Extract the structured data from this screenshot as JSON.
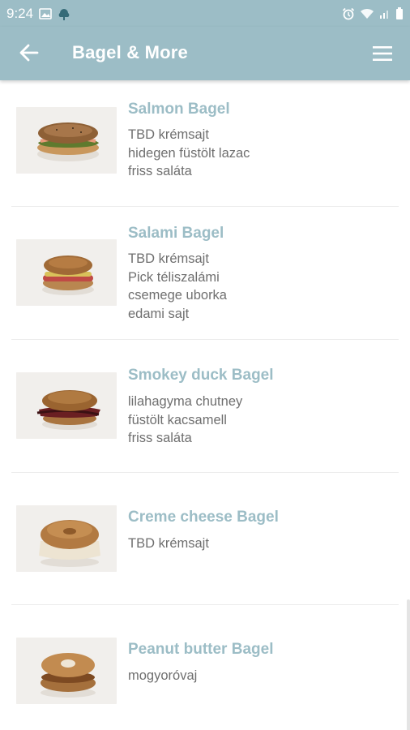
{
  "status_bar": {
    "time": "9:24",
    "icons_left": [
      "image-icon",
      "cloud-icon"
    ],
    "icons_right": [
      "alarm-icon",
      "wifi-icon",
      "signal-icon",
      "battery-icon"
    ]
  },
  "app_bar": {
    "title": "Bagel & More",
    "back_icon": "arrow-left-icon",
    "menu_icon": "hamburger-menu-icon"
  },
  "colors": {
    "accent": "#9cbdc6",
    "text_muted": "#6f6f6f"
  },
  "items": [
    {
      "name": "Salmon Bagel",
      "lines": [
        "TBD krémsajt",
        "hidegen füstölt lazac",
        "friss saláta"
      ],
      "image": "bagel-salmon"
    },
    {
      "name": "Salami Bagel",
      "lines": [
        "TBD krémsajt",
        "Pick téliszalámi",
        "csemege uborka",
        "edami sajt"
      ],
      "image": "bagel-salami"
    },
    {
      "name": "Smokey duck Bagel",
      "lines": [
        "lilahagyma chutney",
        "füstölt kacsamell",
        "friss saláta"
      ],
      "image": "bagel-duck"
    },
    {
      "name": "Creme cheese Bagel",
      "lines": [
        "TBD krémsajt"
      ],
      "image": "bagel-cream-cheese"
    },
    {
      "name": "Peanut butter Bagel",
      "lines": [
        "mogyoróvaj"
      ],
      "image": "bagel-peanut-butter"
    }
  ]
}
